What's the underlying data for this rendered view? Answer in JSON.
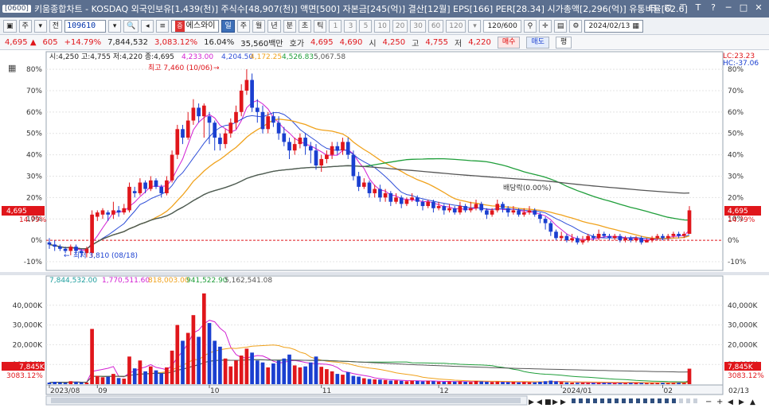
{
  "titlebar": {
    "window_id": "[0600]",
    "title": "키움종합차트 - KOSDAQ 외국인보유[1,439(천)] 주식수[48,907(천)] 액면[500] 자본금[245(억)] 결산[12월] EPS[166] PER[28.34] 시가총액[2,296(억)] 유통비율[62.6]",
    "buttons": [
      "⊟",
      "⊡",
      "⊤",
      "T",
      "?",
      "─",
      "□",
      "✕"
    ]
  },
  "toolbar": {
    "stock_type": "주",
    "prefix": "전",
    "code": "109610",
    "stock_name": "에스와이",
    "name_tag": "증",
    "periods": [
      "일",
      "주",
      "월",
      "년",
      "분",
      "초",
      "틱"
    ],
    "active_period": "일",
    "minutes": [
      "1",
      "3",
      "5",
      "10",
      "20",
      "30",
      "60",
      "120"
    ],
    "count": "120",
    "count_total": "/600",
    "date": "2024/02/13"
  },
  "pricebar": {
    "price": "4,695",
    "change": "605",
    "change_pct": "+14.79%",
    "volume": "7,844,532",
    "volume_ratio": "3,083.12%",
    "turnover": "16.04%",
    "amount": "35,560백만",
    "ask_label": "호가",
    "ask1": "4,695",
    "ask2": "4,690",
    "open_label": "시",
    "open": "4,250",
    "high_label": "고",
    "high": "4,755",
    "low_label": "저",
    "low": "4,220",
    "buy_label": "매수",
    "sell_label": "매도",
    "avg_label": "평"
  },
  "price_legend": {
    "ohlc": "시:4,250 고:4,755 저:4,220 종:4,695",
    "ma": [
      "4,233.00",
      "4,204.50",
      "4,172.25",
      "4,526.83",
      "5,067.58"
    ],
    "ma_colors": [
      "#d21fd2",
      "#2f4fd8",
      "#f0a21c",
      "#1f9e3a",
      "#555555"
    ]
  },
  "volume_legend": {
    "vol": "7,844,532.00",
    "ma": [
      "1,770,511.60",
      "818,003.00",
      "941,522.90",
      "5,162,541.08"
    ],
    "ma_colors": [
      "#d21fd2",
      "#f0a21c",
      "#1f9e3a",
      "#555555"
    ]
  },
  "annotations": {
    "high": "최고 7,460 (10/06)",
    "low": "최저 3,810 (08/18)",
    "dividend": "배당락(0.00%)",
    "lc": "LC:23.23",
    "hc": "HC:-37.06",
    "last_price": "4,695",
    "last_pct": "14.79%",
    "last_vol": "7,845K",
    "last_vol_pct": "3083.12%"
  },
  "colors": {
    "up": "#e0161b",
    "down": "#1a3fd0",
    "grid": "#e4e4e4",
    "panel_bg": "#ffffff"
  },
  "chart_data": {
    "type": "bar",
    "title": "",
    "price_axis": {
      "ylim": [
        -13,
        83
      ],
      "ticks": [
        80,
        70,
        60,
        50,
        40,
        30,
        20,
        10,
        0,
        -10
      ],
      "unit": "%"
    },
    "volume_axis": {
      "ylim": [
        0,
        50000
      ],
      "ticks": [
        40000,
        30000,
        20000,
        10000
      ],
      "tick_labels": [
        "40,000K",
        "30,000K",
        "20,000K",
        "10,000K"
      ]
    },
    "x_labels": [
      "2023/08",
      "09",
      "10",
      "11",
      "12",
      "2024/01",
      "02",
      "02/13"
    ],
    "x_label_index": [
      0,
      9,
      30,
      51,
      73,
      96,
      115,
      119
    ],
    "candles_pct": [
      [
        -1,
        -2,
        1,
        -4
      ],
      [
        -2,
        -3,
        0,
        -5
      ],
      [
        -3,
        -4,
        -2,
        -5
      ],
      [
        -4,
        -5,
        -3,
        -6
      ],
      [
        -5,
        -3,
        -2,
        -7
      ],
      [
        -3,
        -5,
        -2,
        -6
      ],
      [
        -5,
        -6,
        -4,
        -8
      ],
      [
        -6,
        -4,
        -3,
        -8
      ],
      [
        -6,
        12,
        14,
        -8
      ],
      [
        11,
        13,
        14,
        9
      ],
      [
        12,
        14,
        15,
        10
      ],
      [
        13,
        12,
        14,
        9
      ],
      [
        12,
        14,
        18,
        10
      ],
      [
        14,
        13,
        16,
        11
      ],
      [
        13,
        15,
        17,
        12
      ],
      [
        14,
        25,
        27,
        13
      ],
      [
        23,
        22,
        25,
        20
      ],
      [
        22,
        27,
        29,
        21
      ],
      [
        27,
        24,
        28,
        22
      ],
      [
        24,
        28,
        30,
        23
      ],
      [
        28,
        25,
        29,
        24
      ],
      [
        25,
        22,
        26,
        20
      ],
      [
        22,
        28,
        30,
        21
      ],
      [
        28,
        40,
        42,
        27
      ],
      [
        40,
        52,
        54,
        38
      ],
      [
        52,
        48,
        54,
        45
      ],
      [
        48,
        56,
        60,
        47
      ],
      [
        56,
        62,
        66,
        54
      ],
      [
        62,
        58,
        64,
        55
      ],
      [
        58,
        63,
        64,
        48
      ],
      [
        58,
        55,
        60,
        45
      ],
      [
        55,
        48,
        56,
        42
      ],
      [
        48,
        45,
        50,
        42
      ],
      [
        45,
        50,
        52,
        43
      ],
      [
        50,
        55,
        57,
        48
      ],
      [
        55,
        60,
        63,
        52
      ],
      [
        60,
        70,
        73,
        58
      ],
      [
        70,
        75,
        80,
        68
      ],
      [
        75,
        62,
        78,
        60
      ],
      [
        62,
        60,
        66,
        55
      ],
      [
        60,
        52,
        63,
        50
      ],
      [
        52,
        58,
        60,
        50
      ],
      [
        58,
        55,
        60,
        53
      ],
      [
        55,
        50,
        58,
        47
      ],
      [
        50,
        46,
        53,
        44
      ],
      [
        46,
        42,
        48,
        38
      ],
      [
        42,
        45,
        48,
        40
      ],
      [
        45,
        48,
        50,
        43
      ],
      [
        48,
        44,
        50,
        40
      ],
      [
        44,
        42,
        46,
        36
      ],
      [
        42,
        35,
        45,
        33
      ],
      [
        35,
        38,
        40,
        32
      ],
      [
        38,
        40,
        42,
        36
      ],
      [
        40,
        44,
        46,
        38
      ],
      [
        44,
        42,
        46,
        40
      ],
      [
        42,
        46,
        48,
        40
      ],
      [
        46,
        40,
        48,
        38
      ],
      [
        40,
        30,
        42,
        28
      ],
      [
        30,
        25,
        32,
        23
      ],
      [
        25,
        27,
        29,
        24
      ],
      [
        27,
        22,
        28,
        20
      ],
      [
        22,
        24,
        26,
        20
      ],
      [
        24,
        20,
        26,
        18
      ],
      [
        20,
        22,
        24,
        18
      ],
      [
        22,
        18,
        23,
        16
      ],
      [
        18,
        20,
        22,
        17
      ],
      [
        20,
        17,
        21,
        15
      ],
      [
        17,
        19,
        20,
        16
      ],
      [
        19,
        20,
        22,
        18
      ],
      [
        20,
        18,
        21,
        16
      ],
      [
        18,
        16,
        19,
        14
      ],
      [
        16,
        18,
        19,
        15
      ],
      [
        18,
        15,
        19,
        13
      ],
      [
        15,
        16,
        18,
        14
      ],
      [
        16,
        14,
        17,
        12
      ],
      [
        14,
        15,
        17,
        13
      ],
      [
        15,
        13,
        16,
        12
      ],
      [
        13,
        16,
        18,
        12
      ],
      [
        16,
        14,
        17,
        13
      ],
      [
        14,
        15,
        18,
        13
      ],
      [
        15,
        17,
        19,
        14
      ],
      [
        17,
        14,
        18,
        13
      ],
      [
        14,
        12,
        15,
        10
      ],
      [
        12,
        14,
        15,
        11
      ],
      [
        14,
        17,
        19,
        13
      ],
      [
        17,
        15,
        18,
        13
      ],
      [
        15,
        13,
        16,
        11
      ],
      [
        13,
        14,
        16,
        12
      ],
      [
        14,
        12,
        15,
        11
      ],
      [
        12,
        13,
        15,
        11
      ],
      [
        13,
        14,
        16,
        12
      ],
      [
        14,
        12,
        15,
        11
      ],
      [
        12,
        10,
        13,
        8
      ],
      [
        10,
        8,
        11,
        5
      ],
      [
        8,
        4,
        9,
        2
      ],
      [
        4,
        1,
        5,
        0
      ],
      [
        1,
        2,
        4,
        0
      ],
      [
        2,
        0,
        3,
        -1
      ],
      [
        0,
        1,
        3,
        -1
      ],
      [
        1,
        -1,
        2,
        -2
      ],
      [
        -1,
        0,
        2,
        -2
      ],
      [
        0,
        2,
        3,
        -1
      ],
      [
        2,
        1,
        3,
        0
      ],
      [
        1,
        3,
        5,
        0
      ],
      [
        3,
        2,
        4,
        1
      ],
      [
        2,
        1,
        3,
        0
      ],
      [
        1,
        2,
        3,
        0
      ],
      [
        2,
        0,
        3,
        -1
      ],
      [
        0,
        1,
        2,
        -1
      ],
      [
        1,
        0,
        2,
        -1
      ],
      [
        0,
        1,
        2,
        -1
      ],
      [
        1,
        -1,
        2,
        -2
      ],
      [
        -1,
        0,
        1,
        -1
      ],
      [
        0,
        1,
        2,
        -1
      ],
      [
        1,
        2,
        3,
        0
      ],
      [
        2,
        1,
        3,
        0
      ],
      [
        1,
        2,
        3,
        0
      ],
      [
        2,
        3,
        4,
        1
      ],
      [
        3,
        2,
        4,
        1
      ],
      [
        2,
        3,
        4,
        1
      ],
      [
        3,
        14,
        16,
        3
      ]
    ],
    "volume_k": [
      800,
      1200,
      900,
      700,
      1500,
      1100,
      900,
      800,
      28000,
      4200,
      3500,
      3800,
      5200,
      3100,
      2800,
      14000,
      8000,
      12000,
      6500,
      9000,
      7000,
      5500,
      8500,
      17000,
      30000,
      22000,
      26000,
      35000,
      24000,
      46000,
      31000,
      22000,
      19000,
      13000,
      9000,
      12000,
      14500,
      18000,
      16000,
      12000,
      11000,
      8500,
      10500,
      12000,
      13000,
      15000,
      9500,
      8500,
      9000,
      11000,
      14000,
      8800,
      7600,
      6500,
      5200,
      4800,
      6100,
      4200,
      3800,
      3000,
      2600,
      2400,
      2300,
      2100,
      1800,
      1900,
      1700,
      1500,
      1800,
      1600,
      1400,
      1700,
      1500,
      1300,
      1200,
      1400,
      1300,
      1500,
      1200,
      1100,
      1600,
      1400,
      1200,
      1100,
      1300,
      1100,
      1000,
      1200,
      900,
      1100,
      1000,
      950,
      1200,
      1500,
      1800,
      1400,
      1100,
      900,
      800,
      700,
      750,
      650,
      600,
      700,
      650,
      600,
      550,
      580,
      600,
      650,
      700,
      620,
      580,
      600,
      650,
      700,
      620,
      680,
      720,
      650,
      7845
    ]
  }
}
